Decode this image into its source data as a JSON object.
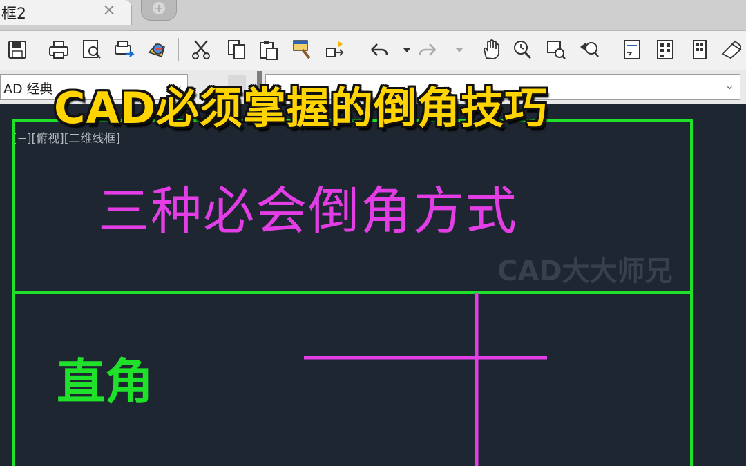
{
  "tab": {
    "label": "框2",
    "close": "×",
    "new_icon": "+"
  },
  "toolbar": {
    "icons": [
      "save-icon",
      "print-icon",
      "print-preview-icon",
      "plot-icon",
      "publish-icon",
      "cut-icon",
      "copy-icon",
      "paste-icon",
      "match-properties-icon",
      "block-editor-icon",
      "undo-icon",
      "redo-icon",
      "pan-icon",
      "zoom-realtime-icon",
      "zoom-window-icon",
      "zoom-previous-icon",
      "properties-icon",
      "design-center-icon",
      "tool-palettes-icon",
      "markup-icon"
    ]
  },
  "workspace": {
    "selected": "AD 经典",
    "arrow": "⌄"
  },
  "video_title": "CAD必须掌握的倒角技巧",
  "viewport_label": "[−][俯视][二维线框]",
  "watermark": "CAD大大师兄",
  "drawing": {
    "heading": "三种必会倒角方式",
    "label": "直角",
    "colors": {
      "frame": "#1fe12a",
      "lines": "#e33ee6",
      "background": "#1e2631"
    }
  }
}
